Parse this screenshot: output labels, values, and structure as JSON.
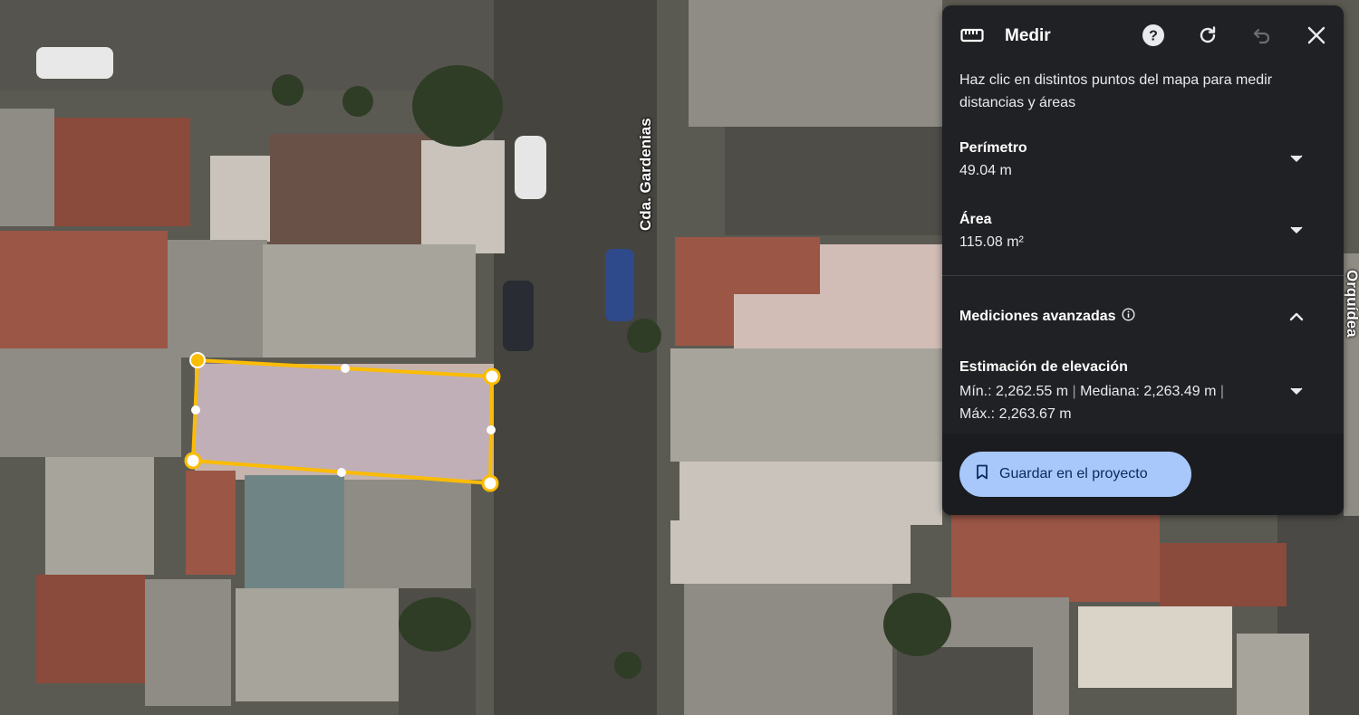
{
  "map": {
    "street_labels": [
      "Cda. Gardenias",
      "Orquídea"
    ],
    "accent_color": "#fbbc04"
  },
  "panel": {
    "title": "Medir",
    "icons": {
      "ruler": "ruler-icon",
      "help": "help-icon",
      "reset": "refresh-icon",
      "undo": "undo-icon",
      "close": "close-icon"
    },
    "description": "Haz clic en distintos puntos del mapa para medir distancias y áreas",
    "perimeter": {
      "label": "Perímetro",
      "value": "49.04 m"
    },
    "area": {
      "label": "Área",
      "value": "115.08 m²"
    },
    "advanced": {
      "label": "Mediciones avanzadas",
      "info_icon": "info-icon"
    },
    "elevation": {
      "label": "Estimación de elevación",
      "min": "Mín.: 2,262.55 m",
      "median": "Mediana: 2,263.49 m",
      "max": "Máx.: 2,263.67 m",
      "separator": "|"
    },
    "save_button": "Guardar en el proyecto"
  }
}
